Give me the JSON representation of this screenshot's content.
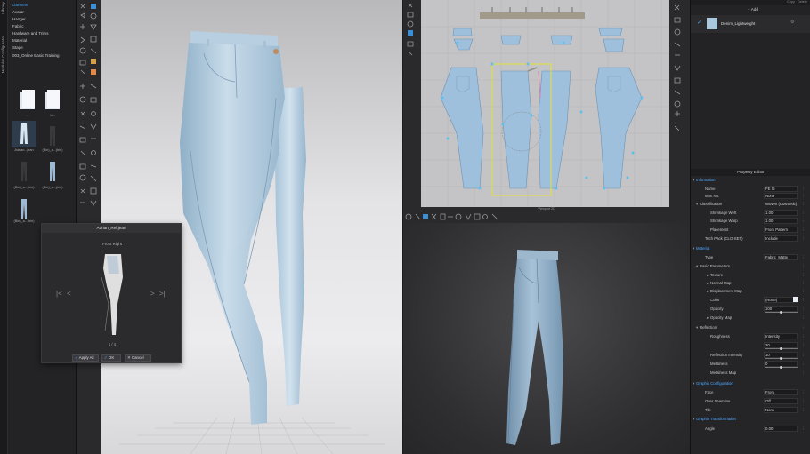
{
  "library": {
    "vertical_tabs": [
      "Library",
      "Modular Configurator"
    ],
    "tree": [
      "Garment",
      "Avatar",
      "Hanger",
      "Fabric",
      "Hardware and Trims",
      "Material",
      "Stage",
      "003_Online Basic Training"
    ],
    "thumbnails": [
      {
        "label": "..."
      },
      {
        "label": "bin"
      },
      {
        "label": "Adrian...jean"
      },
      {
        "label": "(Bin)_a...(bin)"
      },
      {
        "label": "(Bin)_a...(bin)"
      },
      {
        "label": "(Bin)_a...(bin)"
      },
      {
        "label": "(Bin)_a...(bin)"
      }
    ]
  },
  "ref_dialog": {
    "title": "Adrian_Ref.jean",
    "view_label": "Front Right",
    "counter": "1 / 4",
    "buttons": {
      "apply_all": "Apply All",
      "ok": "OK",
      "cancel": "Cancel"
    },
    "nav": {
      "first": "|<",
      "prev": "<",
      "next": ">",
      "last": ">|"
    }
  },
  "view2d": {
    "status": "Viewport 2D"
  },
  "object_browser": {
    "add_label": "Add",
    "right_tabs": [
      "Copy",
      "Delete"
    ],
    "fabric_item": "Denim_Lightweight"
  },
  "property_editor": {
    "title": "Property Editor",
    "rows": [
      {
        "type": "section",
        "label": "Information"
      },
      {
        "type": "field",
        "label": "Name",
        "value": "FE Si"
      },
      {
        "type": "field",
        "label": "Item No.",
        "value": "None"
      },
      {
        "type": "sub",
        "label": "Classification",
        "value": "Woven (Cosmetic)"
      },
      {
        "type": "field2",
        "label": "Shrinkage Weft",
        "value": "1.00"
      },
      {
        "type": "field2",
        "label": "Shrinkage Warp",
        "value": "1.00"
      },
      {
        "type": "field2",
        "label": "Placement",
        "value": "Front Pattern"
      },
      {
        "type": "field",
        "label": "Tech Pack (CLO-SET)",
        "value": "Include"
      },
      {
        "type": "section",
        "label": "Material"
      },
      {
        "type": "field",
        "label": "Type",
        "value": "Fabric_Matte"
      },
      {
        "type": "sub",
        "label": "Basic Parameters",
        "value": ""
      },
      {
        "type": "field2",
        "label": "Texture",
        "value": ""
      },
      {
        "type": "field2",
        "label": "Normal Map",
        "value": ""
      },
      {
        "type": "field2",
        "label": "Displacement Map",
        "value": ""
      },
      {
        "type": "field2",
        "label": "Color",
        "value": "(None)"
      },
      {
        "type": "field2",
        "label": "Opacity",
        "value": "100"
      },
      {
        "type": "field2",
        "label": "Opacity Map",
        "value": ""
      },
      {
        "type": "sub",
        "label": "Reflection",
        "value": ""
      },
      {
        "type": "field2",
        "label": "Roughness",
        "value": "Intensity"
      },
      {
        "type": "field3",
        "label": "",
        "value": "30"
      },
      {
        "type": "field2",
        "label": "Reflection Intensity",
        "value": "10"
      },
      {
        "type": "field2",
        "label": "Metalness",
        "value": "0"
      },
      {
        "type": "field2",
        "label": "Metalness Map",
        "value": ""
      },
      {
        "type": "section",
        "label": "Graphic Configuration"
      },
      {
        "type": "field",
        "label": "Face",
        "value": "Front"
      },
      {
        "type": "field",
        "label": "Over Seamline",
        "value": "Off"
      },
      {
        "type": "field",
        "label": "Tile",
        "value": "None"
      },
      {
        "type": "section",
        "label": "Graphic Transformation"
      },
      {
        "type": "field",
        "label": "Angle",
        "value": "0.00"
      }
    ]
  },
  "colors": {
    "accent": "#3ea2ff",
    "denim": "#a9c7dd",
    "pattern_selection": "#e5e234"
  }
}
